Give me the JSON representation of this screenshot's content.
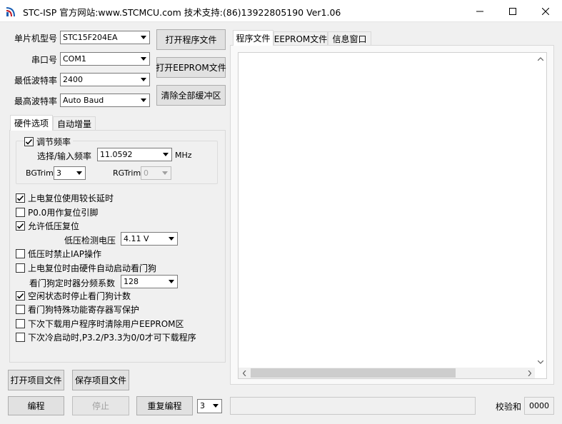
{
  "window": {
    "title": "STC-ISP   官方网站:www.STCMCU.com   技术支持:(86)13922805190   Ver1.06",
    "minimize_label": "—",
    "maximize_label": "☐",
    "close_label": "✕"
  },
  "settings": {
    "chip_label": "单片机型号",
    "chip_value": "STC15F204EA",
    "port_label": "串口号",
    "port_value": "COM1",
    "min_baud_label": "最低波特率",
    "min_baud_value": "2400",
    "max_baud_label": "最高波特率",
    "max_baud_value": "Auto Baud"
  },
  "file_buttons": {
    "open_program": "打开程序文件",
    "open_eeprom": "打开EEPROM文件",
    "clear_buffer": "清除全部缓冲区"
  },
  "left_tabs": [
    "硬件选项",
    "自动增量"
  ],
  "hardware": {
    "freq_group_label": "调节频率",
    "freq_select_label": "选择/输入频率",
    "freq_value": "11.0592",
    "freq_unit": "MHz",
    "bgtrim_label": "BGTrim",
    "bgtrim_value": "3",
    "rgtrim_label": "RGTrim",
    "rgtrim_value": "0",
    "options": [
      {
        "label": "上电复位使用较长延时",
        "checked": true
      },
      {
        "label": "P0.0用作复位引脚",
        "checked": false
      },
      {
        "label": "允许低压复位",
        "checked": true
      },
      {
        "label": "低压时禁止IAP操作",
        "checked": false
      },
      {
        "label": "上电复位时由硬件自动启动看门狗",
        "checked": false
      },
      {
        "label": "空闲状态时停止看门狗计数",
        "checked": true
      },
      {
        "label": "看门狗特殊功能寄存器写保护",
        "checked": false
      },
      {
        "label": "下次下载用户程序时清除用户EEPROM区",
        "checked": false
      },
      {
        "label": "下次冷启动时,P3.2/P3.3为0/0才可下载程序",
        "checked": false
      }
    ],
    "low_volt_label": "低压检测电压",
    "low_volt_value": "4.11 V",
    "wdt_div_label": "看门狗定时器分频系数",
    "wdt_div_value": "128"
  },
  "project_buttons": {
    "open_project": "打开项目文件",
    "save_project": "保存项目文件"
  },
  "right_tabs": [
    "程序文件",
    "EEPROM文件",
    "信息窗口"
  ],
  "bottom": {
    "program_button": "编程",
    "stop_button": "停止",
    "repeat_button": "重复编程",
    "repeat_count": "3",
    "checksum_label": "校验和",
    "checksum_value": "0000"
  },
  "colors": {
    "accent": "#0078d7",
    "disabled_text": "#a0a0a0"
  }
}
